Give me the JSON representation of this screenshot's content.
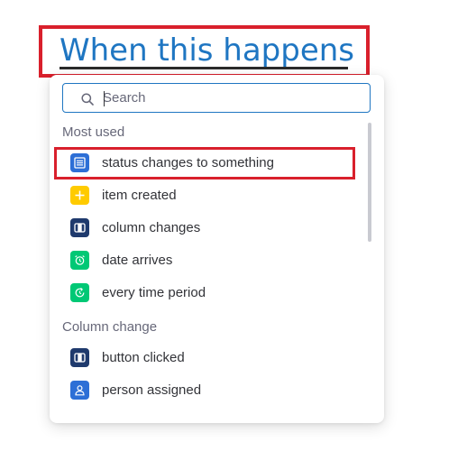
{
  "header": {
    "title": "When this happens"
  },
  "search": {
    "placeholder": "Search",
    "value": ""
  },
  "sections": {
    "most_used": {
      "label": "Most used",
      "items": [
        {
          "label": "status changes to something",
          "icon": "status-column-icon",
          "color": "#2d6fd6"
        },
        {
          "label": "item created",
          "icon": "plus-icon",
          "color": "#ffcb00"
        },
        {
          "label": "column changes",
          "icon": "column-icon",
          "color": "#1f3a6d"
        },
        {
          "label": "date arrives",
          "icon": "alarm-clock-icon",
          "color": "#00c875"
        },
        {
          "label": "every time period",
          "icon": "recurring-icon",
          "color": "#00c875"
        }
      ]
    },
    "column_change": {
      "label": "Column change",
      "items": [
        {
          "label": "button clicked",
          "icon": "button-column-icon",
          "color": "#1f3a6d"
        },
        {
          "label": "person assigned",
          "icon": "person-icon",
          "color": "#2d6fd6"
        }
      ]
    }
  },
  "colors": {
    "accent": "#1f76c2",
    "highlight": "#d9202c",
    "text": "#323338",
    "muted": "#676879"
  }
}
